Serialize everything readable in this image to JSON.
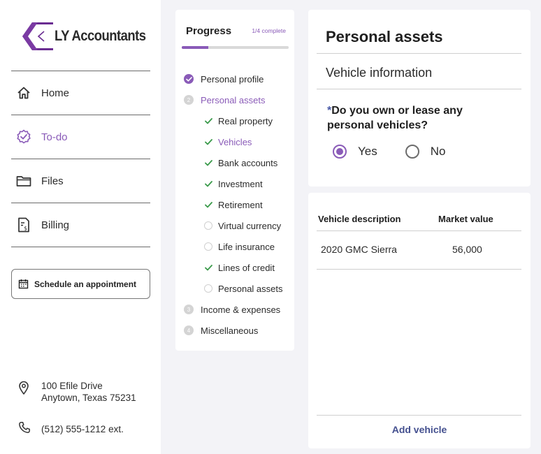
{
  "brand": {
    "name": "LY Accountants",
    "accent": "#8a5bb8"
  },
  "sidebar": {
    "nav": [
      {
        "label": "Home",
        "icon": "home-icon",
        "active": false
      },
      {
        "label": "To-do",
        "icon": "todo-badge-icon",
        "active": true
      },
      {
        "label": "Files",
        "icon": "folder-icon",
        "active": false
      },
      {
        "label": "Billing",
        "icon": "billing-icon",
        "active": false
      }
    ],
    "schedule_button": "Schedule an appointment",
    "address_line1": "100 Efile Drive",
    "address_line2": "Anytown, Texas 75231",
    "phone": "(512) 555-1212 ext."
  },
  "progress": {
    "title": "Progress",
    "count": "1/4 complete",
    "fraction": 0.25,
    "steps": [
      {
        "marker": "done",
        "label": "Personal profile"
      },
      {
        "marker": "2",
        "label": "Personal assets",
        "current": true
      },
      {
        "sub": true,
        "status": "done",
        "label": "Real property"
      },
      {
        "sub": true,
        "status": "done",
        "label": "Vehicles",
        "current": true
      },
      {
        "sub": true,
        "status": "done",
        "label": "Bank accounts"
      },
      {
        "sub": true,
        "status": "done",
        "label": "Investment"
      },
      {
        "sub": true,
        "status": "done",
        "label": "Retirement"
      },
      {
        "sub": true,
        "status": "open",
        "label": "Virtual currency"
      },
      {
        "sub": true,
        "status": "open",
        "label": "Life insurance"
      },
      {
        "sub": true,
        "status": "done",
        "label": "Lines of credit"
      },
      {
        "sub": true,
        "status": "open",
        "label": "Personal assets"
      },
      {
        "marker": "3",
        "label": "Income & expenses"
      },
      {
        "marker": "4",
        "label": "Miscellaneous"
      }
    ]
  },
  "assets": {
    "title": "Personal assets",
    "section": "Vehicle information",
    "question_required_mark": "*",
    "question": "Do you own or lease any personal vehicles?",
    "options": [
      {
        "label": "Yes",
        "selected": true
      },
      {
        "label": "No",
        "selected": false
      }
    ]
  },
  "vehicles": {
    "columns": [
      "Vehicle description",
      "Market value"
    ],
    "rows": [
      {
        "description": "2020 GMC Sierra",
        "value": "56,000"
      }
    ],
    "add_label": "Add vehicle"
  }
}
